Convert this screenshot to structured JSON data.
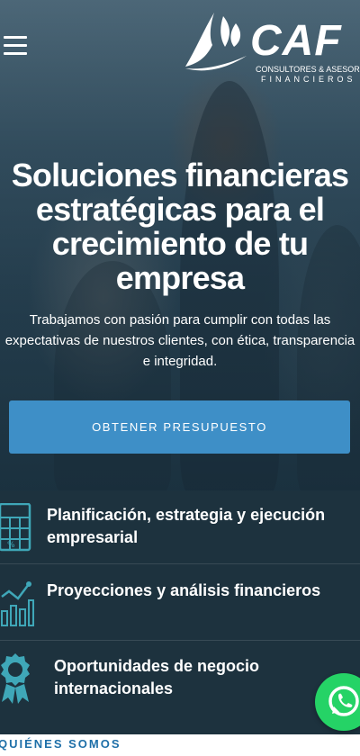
{
  "header": {
    "menu_icon": "hamburger-menu-icon",
    "logo": {
      "brand": "CAF",
      "line1": "CONSULTORES & ASESORES",
      "line2": "FINANCIEROS"
    }
  },
  "hero": {
    "title": "Soluciones financieras estratégicas para el crecimiento de tu empresa",
    "text": "Trabajamos con pasión para cumplir con todas las expectativas de nuestros clientes, con ética, transparencia e integridad.",
    "cta_label": "OBTENER PRESUPUESTO"
  },
  "services": [
    {
      "icon": "calculator-icon",
      "label": "Planificación, estrategia y ejecución empresarial"
    },
    {
      "icon": "bar-chart-icon",
      "label": "Proyecciones y análisis financieros"
    },
    {
      "icon": "award-ribbon-icon",
      "label": "Oportunidades de negocio internacionales"
    }
  ],
  "whatsapp": {
    "icon": "whatsapp-icon"
  },
  "about": {
    "label": "QUIÉNES SOMOS"
  },
  "colors": {
    "accent": "#3e8fc7",
    "services_bg": "#1d323e",
    "icon_teal": "#3fa7b8",
    "whatsapp_green": "#25d366",
    "about_label": "#1e6fa8"
  }
}
